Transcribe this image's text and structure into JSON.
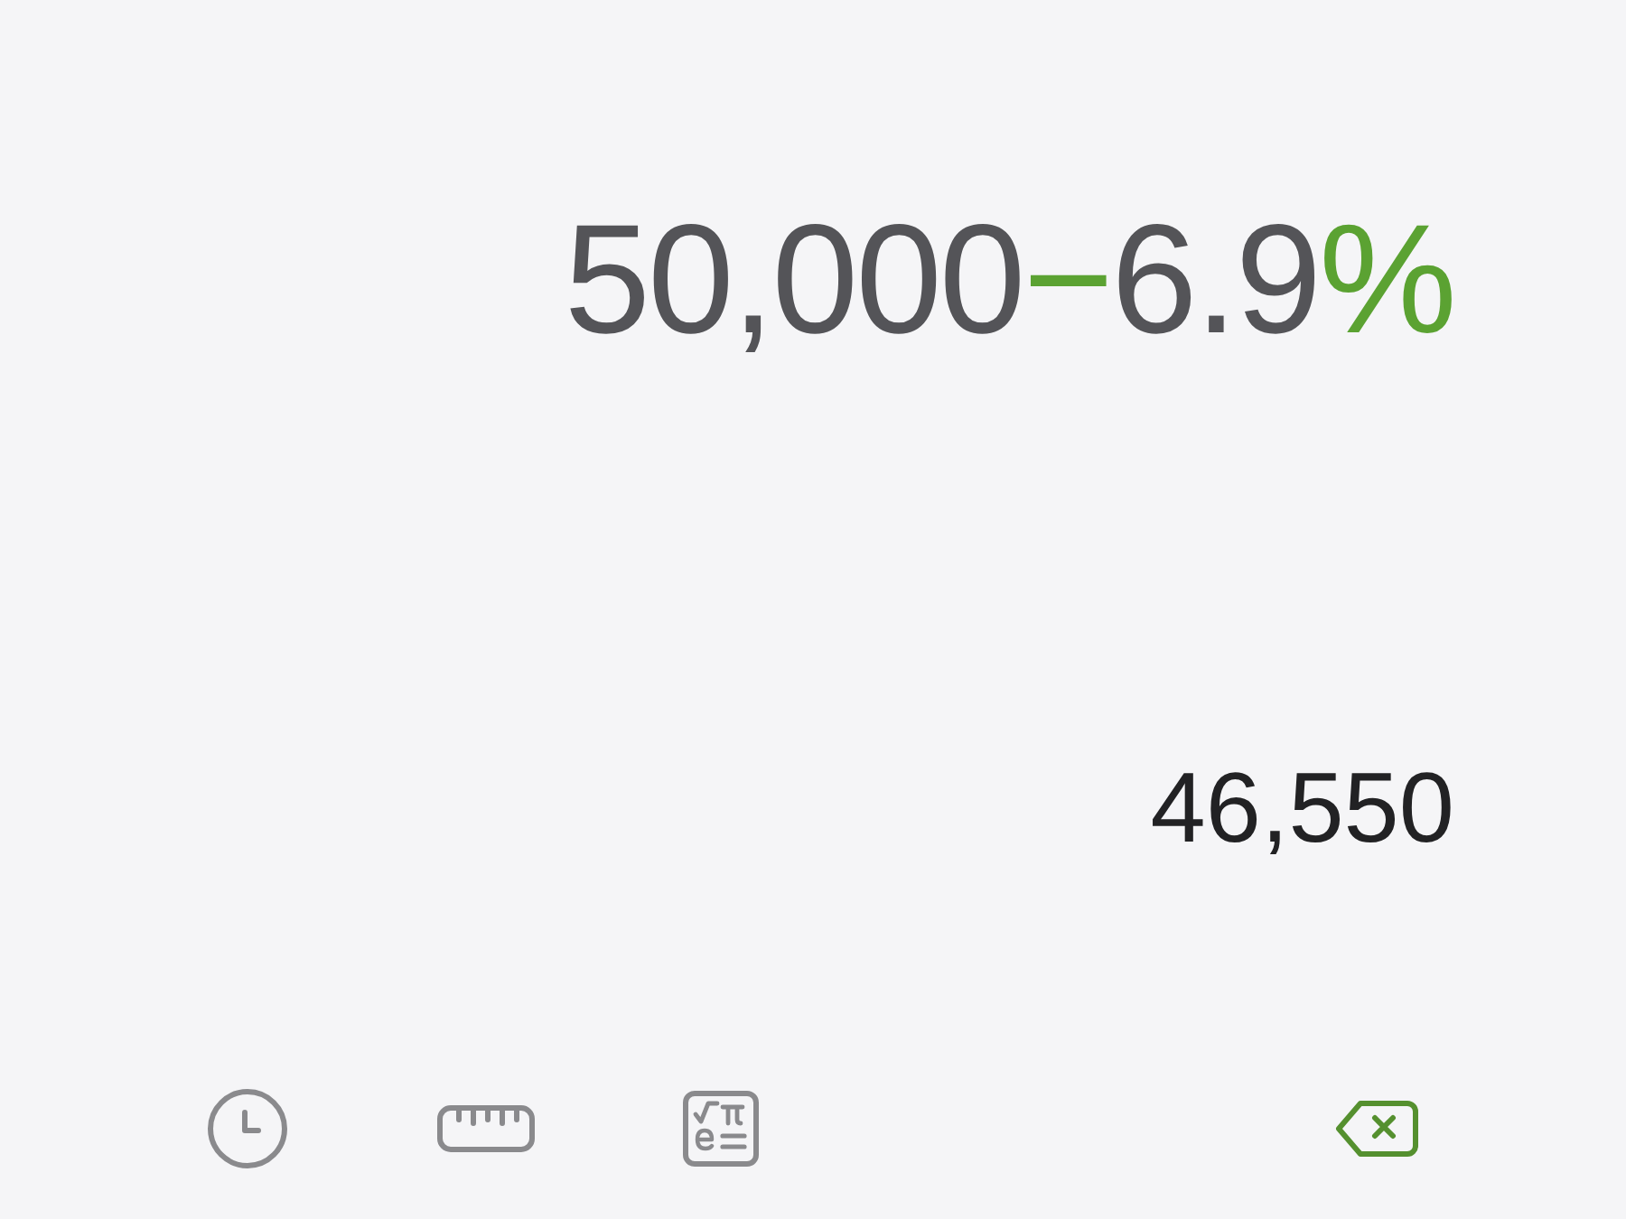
{
  "expression": [
    {
      "kind": "number",
      "text": "50,000"
    },
    {
      "kind": "operator",
      "text": "−"
    },
    {
      "kind": "number",
      "text": "6.9"
    },
    {
      "kind": "operator",
      "text": "%"
    }
  ],
  "result": "46,550",
  "toolbar": [
    {
      "kind": "history"
    },
    {
      "kind": "converter"
    },
    {
      "kind": "scientific"
    },
    {
      "kind": "backspace",
      "disabled": false
    }
  ]
}
